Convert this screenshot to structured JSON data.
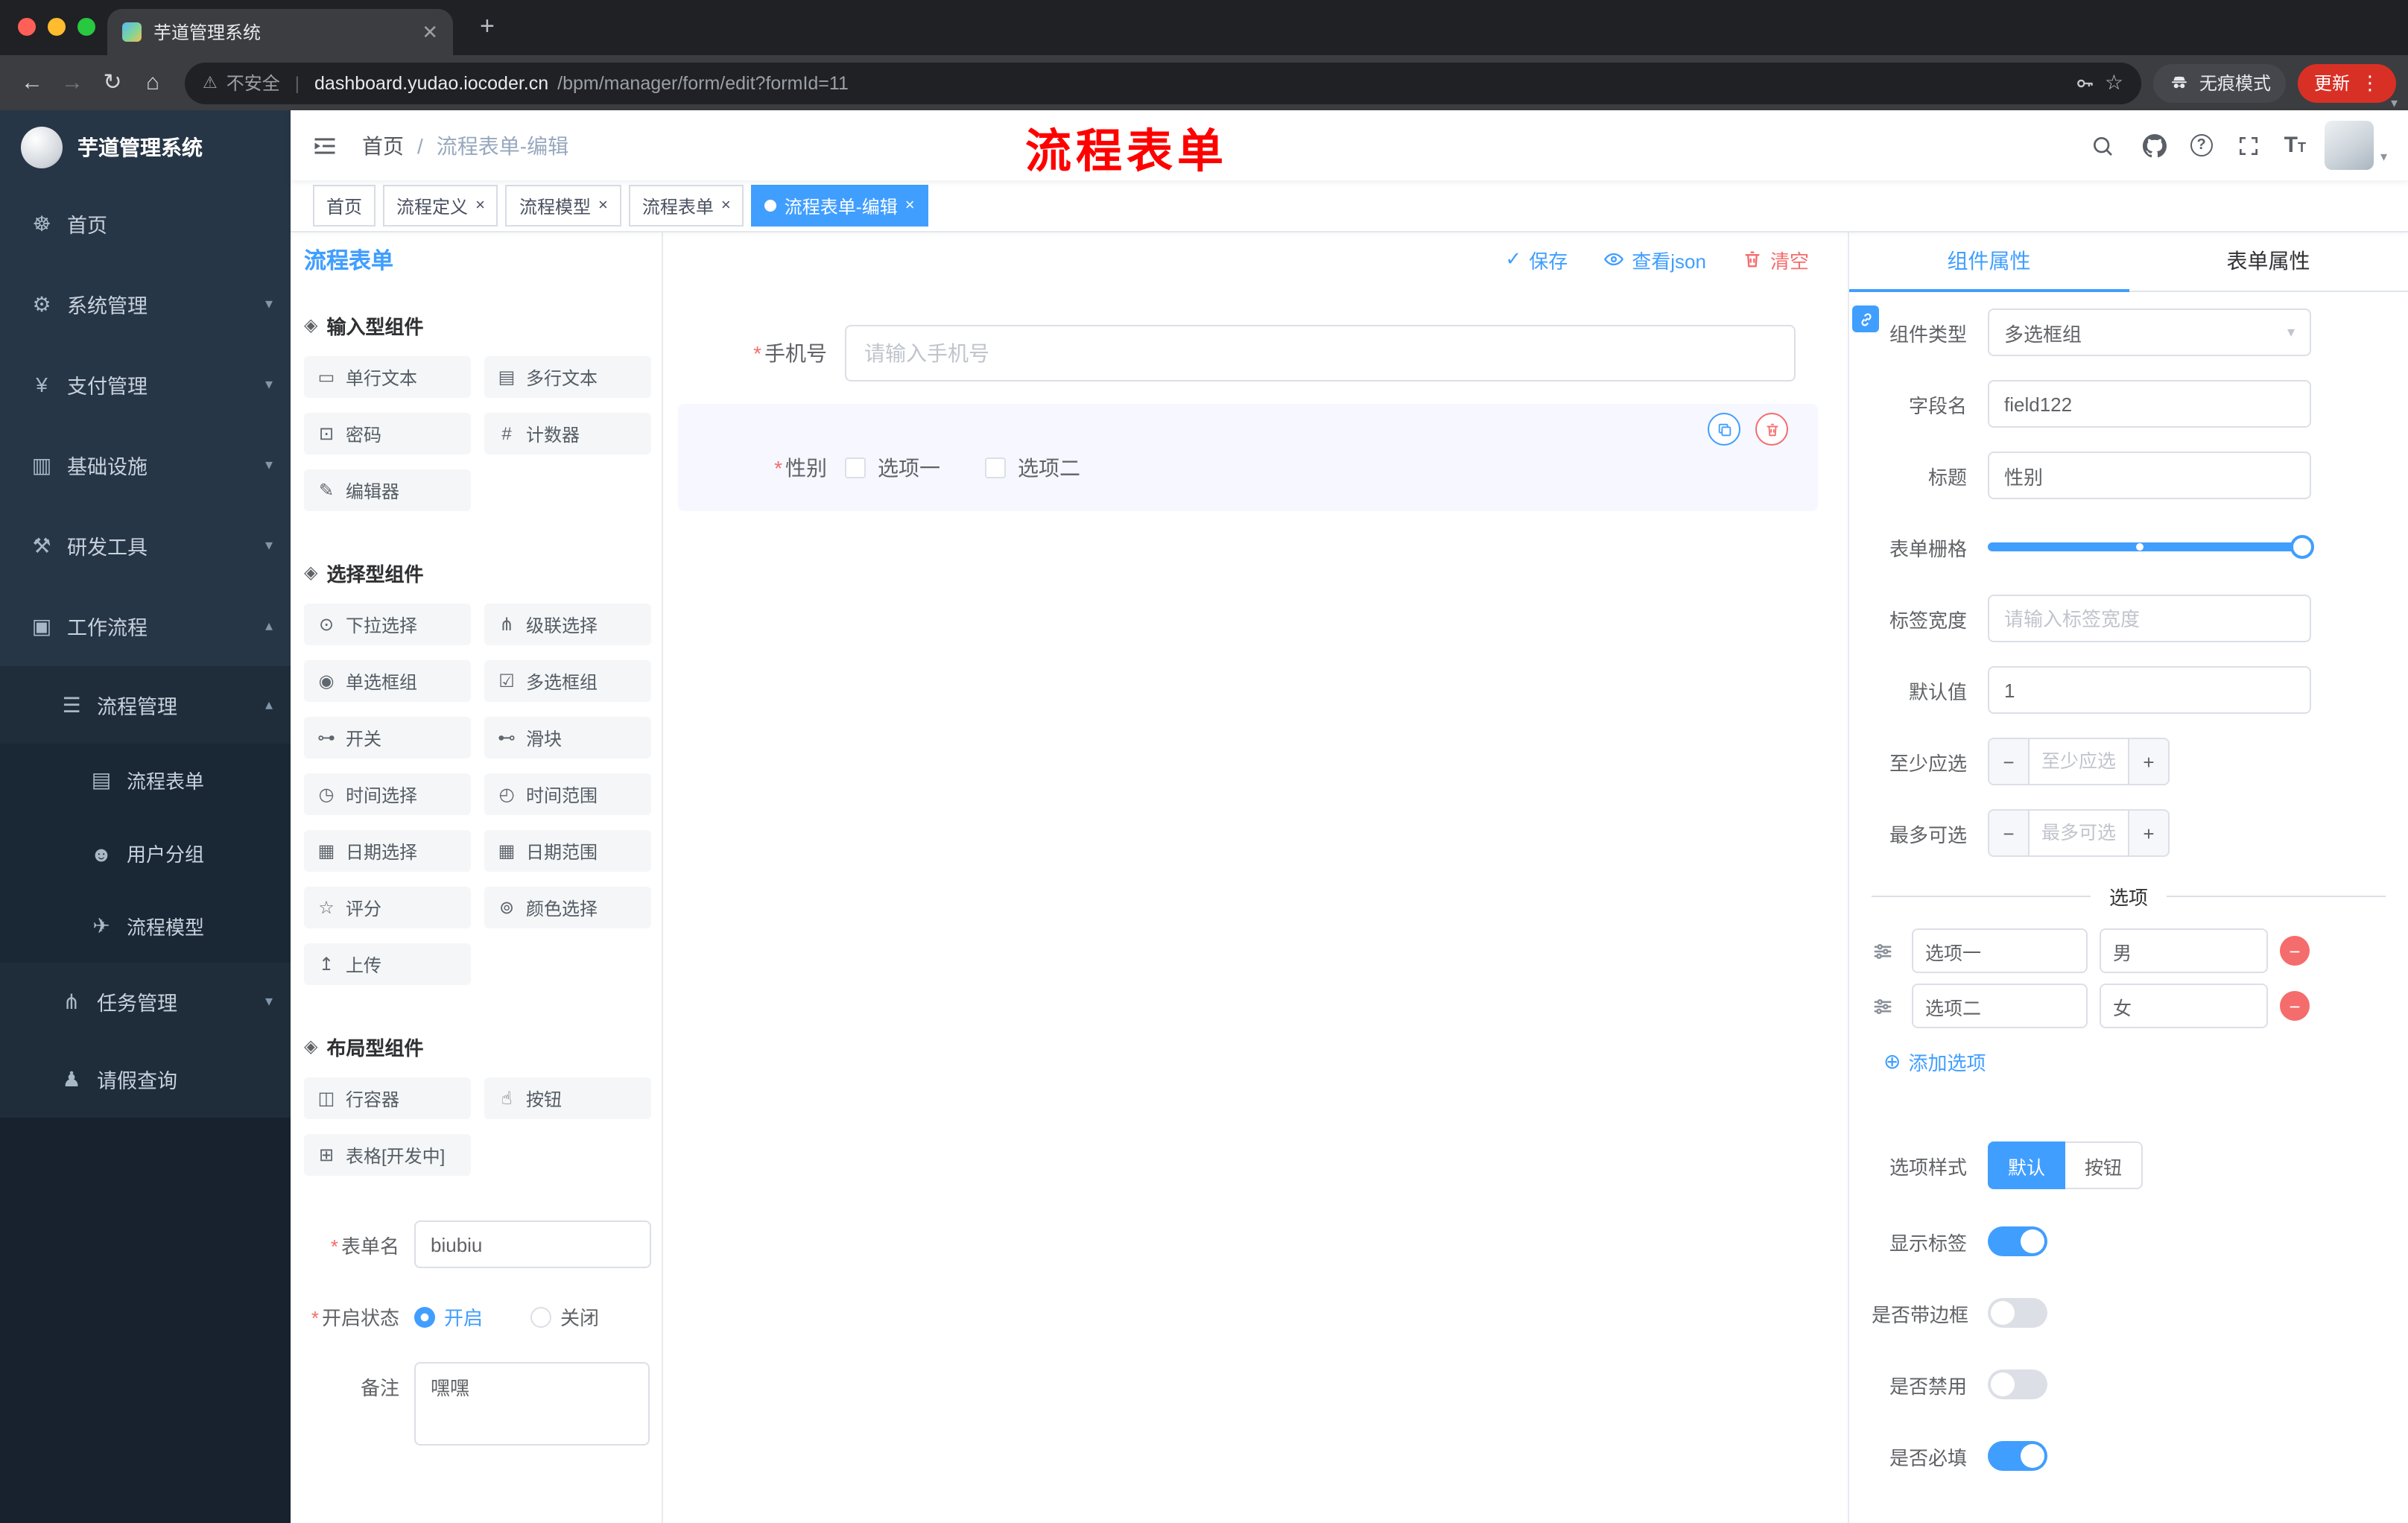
{
  "colors": {
    "accent": "#409eff",
    "danger": "#f56c6c",
    "annotation_red": "#ff0000"
  },
  "browser": {
    "tab": {
      "title": "芋道管理系统"
    },
    "address": {
      "security_label": "不安全",
      "separator": "|",
      "domain": "dashboard.yudao.iocoder.cn",
      "path": "/bpm/manager/form/edit?formId=11"
    },
    "incognito_label": "无痕模式",
    "update_label": "更新"
  },
  "annotation": {
    "text": "流程表单"
  },
  "sidebar": {
    "logo_title": "芋道管理系统",
    "menu": [
      {
        "glyph": "☸",
        "label": "首页"
      },
      {
        "glyph": "⚙",
        "label": "系统管理"
      },
      {
        "glyph": "¥",
        "label": "支付管理"
      },
      {
        "glyph": "▥",
        "label": "基础设施"
      },
      {
        "glyph": "⚒",
        "label": "研发工具"
      },
      {
        "glyph": "▣",
        "label": "工作流程"
      },
      {
        "glyph": "☰",
        "label": "流程管理"
      },
      {
        "glyph": "▤",
        "label": "流程表单"
      },
      {
        "glyph": "☻",
        "label": "用户分组"
      },
      {
        "glyph": "✈",
        "label": "流程模型"
      },
      {
        "glyph": "⋔",
        "label": "任务管理"
      },
      {
        "glyph": "♟",
        "label": "请假查询"
      }
    ]
  },
  "header": {
    "breadcrumb_home": "首页",
    "breadcrumb_sep": "/",
    "breadcrumb_current": "流程表单-编辑"
  },
  "tags": [
    {
      "label": "首页"
    },
    {
      "label": "流程定义"
    },
    {
      "label": "流程模型"
    },
    {
      "label": "流程表单"
    },
    {
      "label": "流程表单-编辑"
    }
  ],
  "designer": {
    "title": "流程表单",
    "actions": {
      "save": "保存",
      "view_json": "查看json",
      "clear": "清空"
    },
    "palette": {
      "groups": [
        {
          "icon_glyph": "◈",
          "title": "输入型组件",
          "items": [
            {
              "glyph": "▭",
              "label": "单行文本"
            },
            {
              "glyph": "▤",
              "label": "多行文本"
            },
            {
              "glyph": "⊡",
              "label": "密码"
            },
            {
              "glyph": "#",
              "label": "计数器"
            },
            {
              "glyph": "✎",
              "label": "编辑器"
            }
          ]
        },
        {
          "icon_glyph": "◈",
          "title": "选择型组件",
          "items": [
            {
              "glyph": "⊙",
              "label": "下拉选择"
            },
            {
              "glyph": "⋔",
              "label": "级联选择"
            },
            {
              "glyph": "◉",
              "label": "单选框组"
            },
            {
              "glyph": "☑",
              "label": "多选框组"
            },
            {
              "glyph": "⊶",
              "label": "开关"
            },
            {
              "glyph": "⊷",
              "label": "滑块"
            },
            {
              "glyph": "◷",
              "label": "时间选择"
            },
            {
              "glyph": "◴",
              "label": "时间范围"
            },
            {
              "glyph": "▦",
              "label": "日期选择"
            },
            {
              "glyph": "▦",
              "label": "日期范围"
            },
            {
              "glyph": "☆",
              "label": "评分"
            },
            {
              "glyph": "⊚",
              "label": "颜色选择"
            },
            {
              "glyph": "↥",
              "label": "上传"
            }
          ]
        },
        {
          "icon_glyph": "◈",
          "title": "布局型组件",
          "items": [
            {
              "glyph": "◫",
              "label": "行容器"
            },
            {
              "glyph": "☝",
              "label": "按钮"
            },
            {
              "glyph": "⊞",
              "label": "表格[开发中]"
            }
          ]
        }
      ]
    },
    "meta": {
      "form_name_label": "表单名",
      "form_name_value": "biubiu",
      "status_label": "开启状态",
      "status_on": "开启",
      "status_off": "关闭",
      "remark_label": "备注",
      "remark_value": "嘿嘿"
    },
    "canvas": {
      "phone": {
        "label": "手机号",
        "placeholder": "请输入手机号"
      },
      "gender": {
        "label": "性别",
        "option1": "选项一",
        "option2": "选项二"
      }
    }
  },
  "props": {
    "tab_component": "组件属性",
    "tab_form": "表单属性",
    "component_type_label": "组件类型",
    "component_type_value": "多选框组",
    "field_name_label": "字段名",
    "field_name_value": "field122",
    "title_label": "标题",
    "title_value": "性别",
    "grid_label": "表单栅格",
    "label_width_label": "标签宽度",
    "label_width_placeholder": "请输入标签宽度",
    "default_label": "默认值",
    "default_value": "1",
    "min_label": "至少应选",
    "min_placeholder": "至少应选",
    "max_label": "最多可选",
    "max_placeholder": "最多可选",
    "options_divider": "选项",
    "options": [
      {
        "label": "选项一",
        "value": "男"
      },
      {
        "label": "选项二",
        "value": "女"
      }
    ],
    "add_option": "添加选项",
    "style_label": "选项样式",
    "style_default": "默认",
    "style_button": "按钮",
    "show_label_label": "显示标签",
    "border_label": "是否带边框",
    "disabled_label": "是否禁用",
    "required_label": "是否必填"
  }
}
